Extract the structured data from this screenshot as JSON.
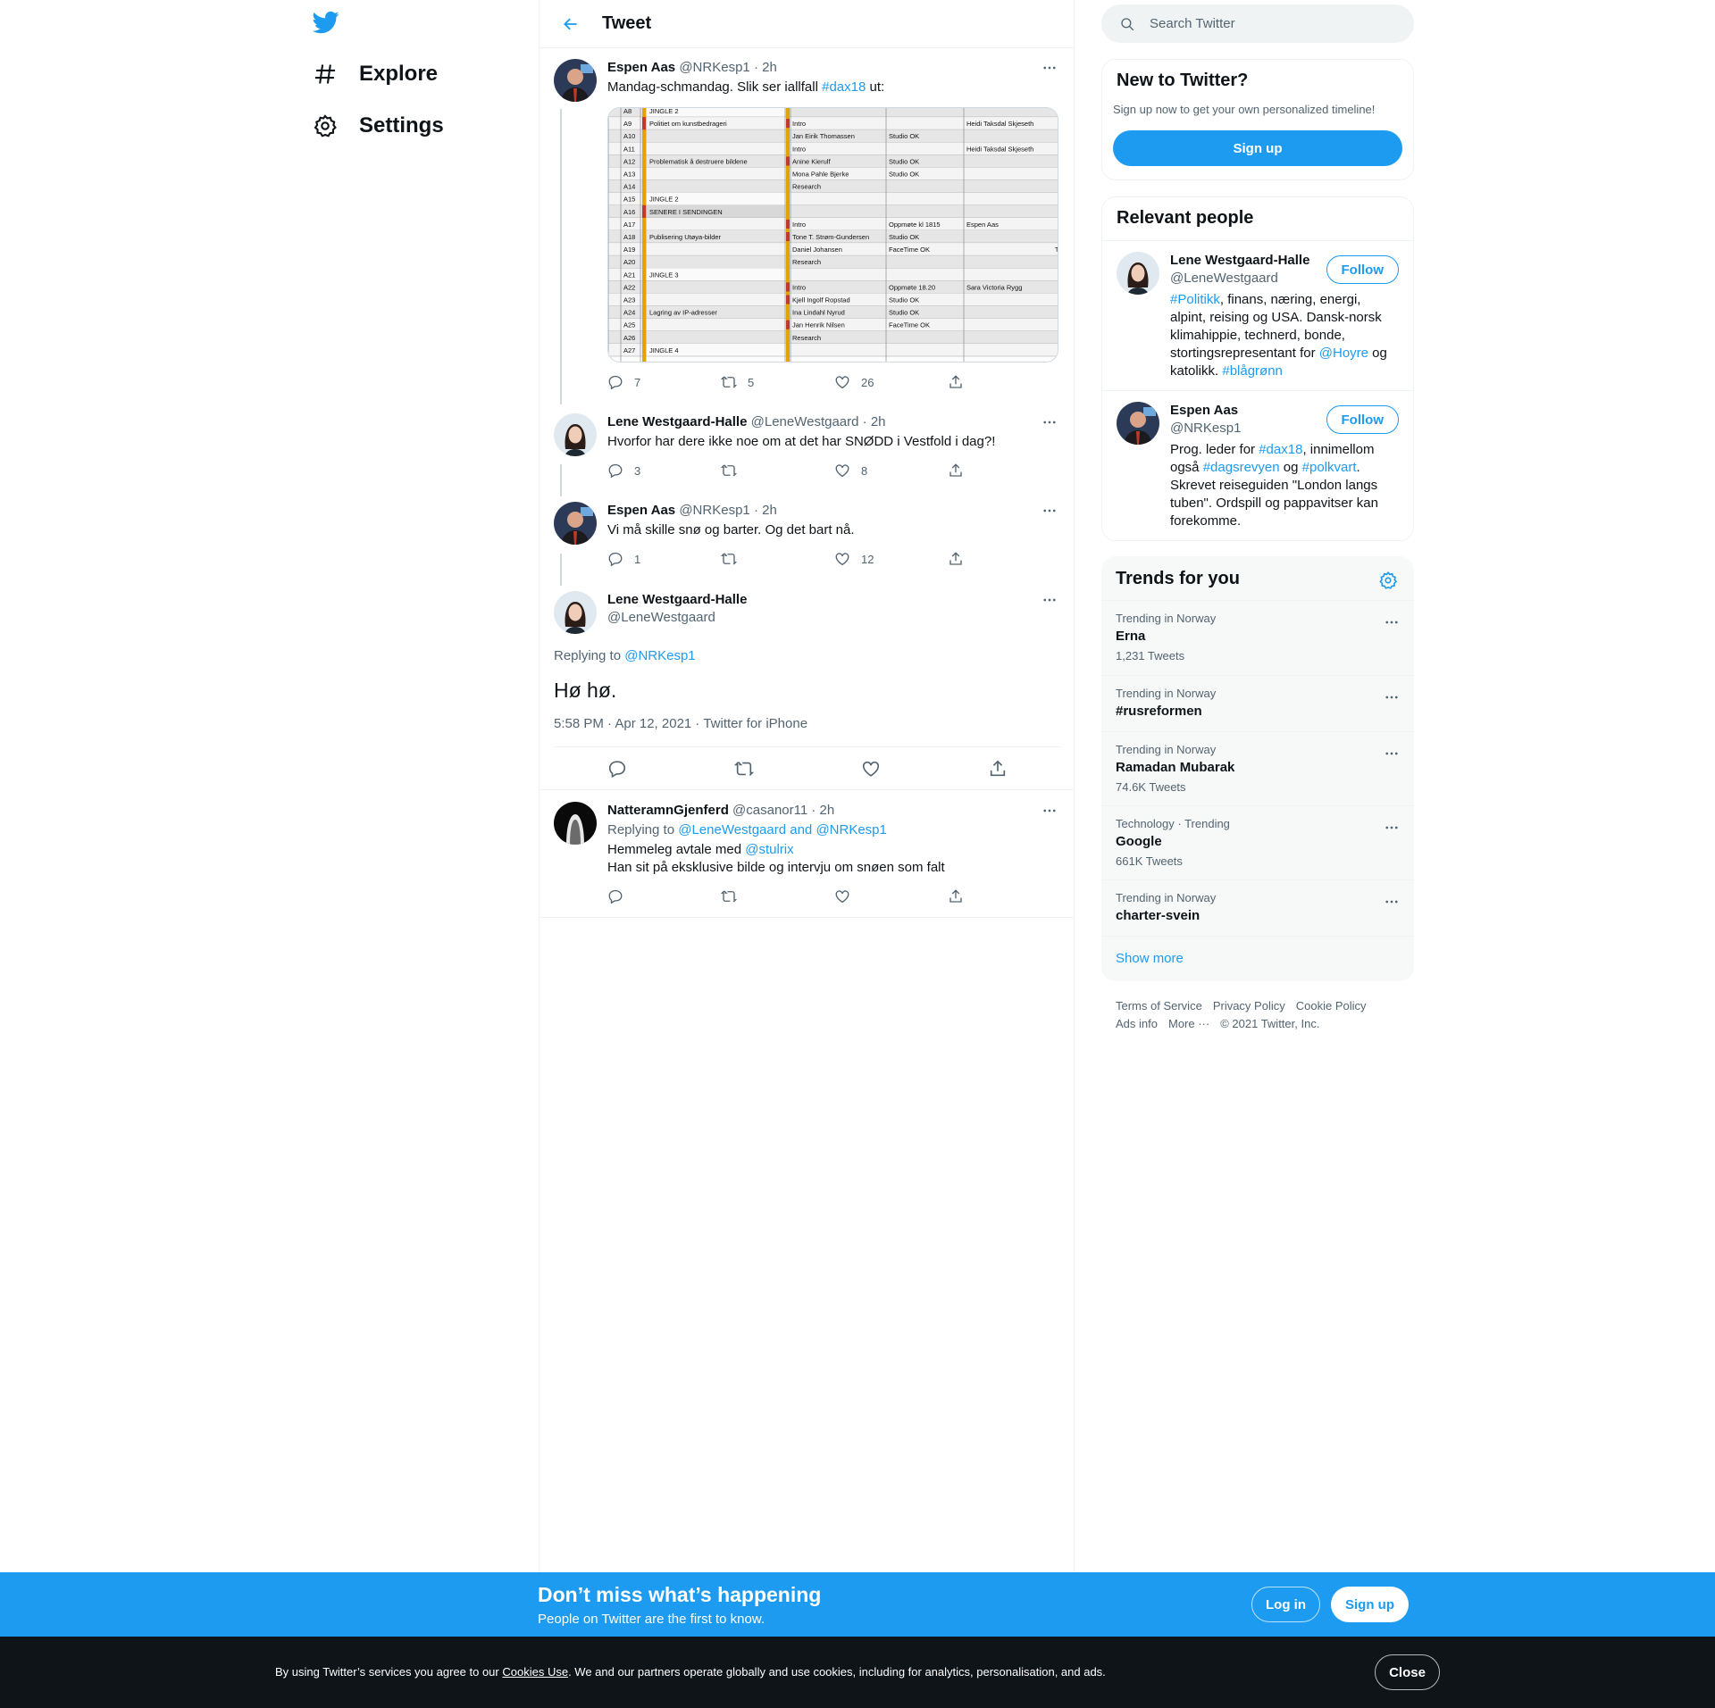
{
  "nav": {
    "logo": "twitter-bird",
    "items": [
      {
        "label": "Explore",
        "icon": "hashtag-icon"
      },
      {
        "label": "Settings",
        "icon": "gear-icon"
      }
    ]
  },
  "header": {
    "title": "Tweet",
    "back_icon": "arrow-left-icon"
  },
  "tweets": [
    {
      "name": "Espen Aas",
      "handle": "@NRKesp1",
      "time": "· 2h",
      "text_before": "Mandag-schmandag. Slik ser iallfall ",
      "hashtag": "#dax18",
      "text_after": " ut:",
      "replies": "7",
      "retweets": "5",
      "likes": "26"
    },
    {
      "name": "Lene Westgaard-Halle",
      "handle": "@LeneWestgaard",
      "time": "· 2h",
      "text": "Hvorfor har dere ikke noe om at det har SNØDD i Vestfold i dag?!",
      "replies": "3",
      "retweets": "",
      "likes": "8"
    },
    {
      "name": "Espen Aas",
      "handle": "@NRKesp1",
      "time": "· 2h",
      "text": "Vi må skille snø og barter. Og det bart nå.",
      "replies": "1",
      "retweets": "",
      "likes": "12"
    }
  ],
  "main_tweet": {
    "name": "Lene Westgaard-Halle",
    "handle": "@LeneWestgaard",
    "replying_label": "Replying to ",
    "replying_to": "@NRKesp1",
    "text": "Hø hø.",
    "meta": "5:58 PM · Apr 12, 2021 · Twitter for iPhone"
  },
  "reply": {
    "name": "NatteramnGjenferd",
    "handle": "@casanor11",
    "time": "· 2h",
    "replying_label": "Replying to ",
    "replying_to": "@LeneWestgaard and @NRKesp1",
    "line1_before": "Hemmeleg avtale med ",
    "line1_mention": "@stulrix",
    "line2": "Han sit på eksklusive bilde og intervju om snøen som falt"
  },
  "media_table": {
    "rows": [
      {
        "id": "A8",
        "seg": "JINGLE 2",
        "role": "",
        "status": "",
        "who": ""
      },
      {
        "id": "A9",
        "seg": "Politiet om kunstbedrageri",
        "role": "Intro",
        "status": "",
        "who": "Heidi Taksdal Skjeseth"
      },
      {
        "id": "A10",
        "seg": "",
        "role": "Jan Eirik Thomassen",
        "status": "Studio OK",
        "who": ""
      },
      {
        "id": "A11",
        "seg": "",
        "role": "Intro",
        "status": "",
        "who": "Heidi Taksdal Skjeseth"
      },
      {
        "id": "A12",
        "seg": "Problematisk å destruere bildene",
        "role": "Anine Kierulf",
        "status": "Studio OK",
        "who": ""
      },
      {
        "id": "A13",
        "seg": "",
        "role": "Mona Pahle Bjerke",
        "status": "Studio OK",
        "who": ""
      },
      {
        "id": "A14",
        "seg": "",
        "role": "Research",
        "status": "",
        "who": ""
      },
      {
        "id": "A15",
        "seg": "JINGLE 2",
        "role": "",
        "status": "",
        "who": ""
      },
      {
        "id": "A16",
        "seg": "SENERE I SENDINGEN",
        "role": "",
        "status": "",
        "who": ""
      },
      {
        "id": "A17",
        "seg": "",
        "role": "Intro",
        "status": "Oppmøte kl 1815",
        "who": "Espen Aas"
      },
      {
        "id": "A18",
        "seg": "Publisering Utøya-bilder",
        "role": "Tone T. Strøm-Gundersen",
        "status": "Studio OK",
        "who": ""
      },
      {
        "id": "A19",
        "seg": "",
        "role": "Daniel Johansen",
        "status": "FaceTime OK",
        "who": ""
      },
      {
        "id": "A20",
        "seg": "",
        "role": "Research",
        "status": "",
        "who": ""
      },
      {
        "id": "A21",
        "seg": "JINGLE 3",
        "role": "",
        "status": "",
        "who": ""
      },
      {
        "id": "A22",
        "seg": "",
        "role": "Intro",
        "status": "Oppmøte 18.20",
        "who": "Sara Victoria Rygg"
      },
      {
        "id": "A23",
        "seg": "",
        "role": "Kjell Ingolf Ropstad",
        "status": "Studio OK",
        "who": ""
      },
      {
        "id": "A24",
        "seg": "Lagring av IP-adresser",
        "role": "Ina Lindahl Nyrud",
        "status": "Studio OK",
        "who": ""
      },
      {
        "id": "A25",
        "seg": "",
        "role": "Jan Henrik Nilsen",
        "status": "FaceTime OK",
        "who": ""
      },
      {
        "id": "A26",
        "seg": "",
        "role": "Research",
        "status": "",
        "who": ""
      },
      {
        "id": "A27",
        "seg": "JINGLE 4",
        "role": "",
        "status": "",
        "who": ""
      }
    ],
    "edge_mark": "T"
  },
  "search": {
    "placeholder": "Search Twitter"
  },
  "new_to_twitter": {
    "title": "New to Twitter?",
    "subtitle": "Sign up now to get your own personalized timeline!",
    "button": "Sign up"
  },
  "relevant": {
    "title": "Relevant people",
    "people": [
      {
        "name": "Lene Westgaard-Halle",
        "handle": "@LeneWestgaard",
        "follow": "Follow",
        "bio": [
          {
            "t": "#Politikk",
            "link": true
          },
          {
            "t": ", finans, næring, energi, alpint, reising og USA. Dansk-norsk klimahippie, technerd, bonde, stortingsrepresentant for ",
            "link": false
          },
          {
            "t": "@Hoyre",
            "link": true
          },
          {
            "t": " og katolikk. ",
            "link": false
          },
          {
            "t": "#blågrønn",
            "link": true
          }
        ]
      },
      {
        "name": "Espen Aas",
        "handle": "@NRKesp1",
        "follow": "Follow",
        "bio": [
          {
            "t": "Prog. leder for ",
            "link": false
          },
          {
            "t": "#dax18",
            "link": true
          },
          {
            "t": ", innimellom også ",
            "link": false
          },
          {
            "t": "#dagsrevyen",
            "link": true
          },
          {
            "t": " og ",
            "link": false
          },
          {
            "t": "#polkvart",
            "link": true
          },
          {
            "t": ". Skrevet reiseguiden \"London langs tuben\". Ordspill og pappavitser kan forekomme.",
            "link": false
          }
        ]
      }
    ]
  },
  "trends": {
    "title": "Trends for you",
    "items": [
      {
        "context": "Trending in Norway",
        "name": "Erna",
        "count": "1,231 Tweets"
      },
      {
        "context": "Trending in Norway",
        "name": "#rusreformen",
        "count": ""
      },
      {
        "context": "Trending in Norway",
        "name": "Ramadan Mubarak",
        "count": "74.6K Tweets"
      },
      {
        "context": "Technology · Trending",
        "name": "Google",
        "count": "661K Tweets"
      },
      {
        "context": "Trending in Norway",
        "name": "charter-svein",
        "count": ""
      }
    ],
    "show_more": "Show more"
  },
  "footer": {
    "links": [
      "Terms of Service",
      "Privacy Policy",
      "Cookie Policy",
      "Ads info",
      "More ···"
    ],
    "copyright": "© 2021 Twitter, Inc."
  },
  "banner": {
    "title": "Don’t miss what’s happening",
    "subtitle": "People on Twitter are the first to know.",
    "login": "Log in",
    "signup": "Sign up"
  },
  "cookie": {
    "before": "By using Twitter’s services you agree to our ",
    "link": "Cookies Use",
    "after": ". We and our partners operate globally and use cookies, including for analytics, personalisation, and ads.",
    "close": "Close"
  },
  "colors": {
    "accent": "#1d9bf0",
    "text": "#0f1419",
    "muted": "#536471",
    "cookie_bg": "#0f1419"
  }
}
